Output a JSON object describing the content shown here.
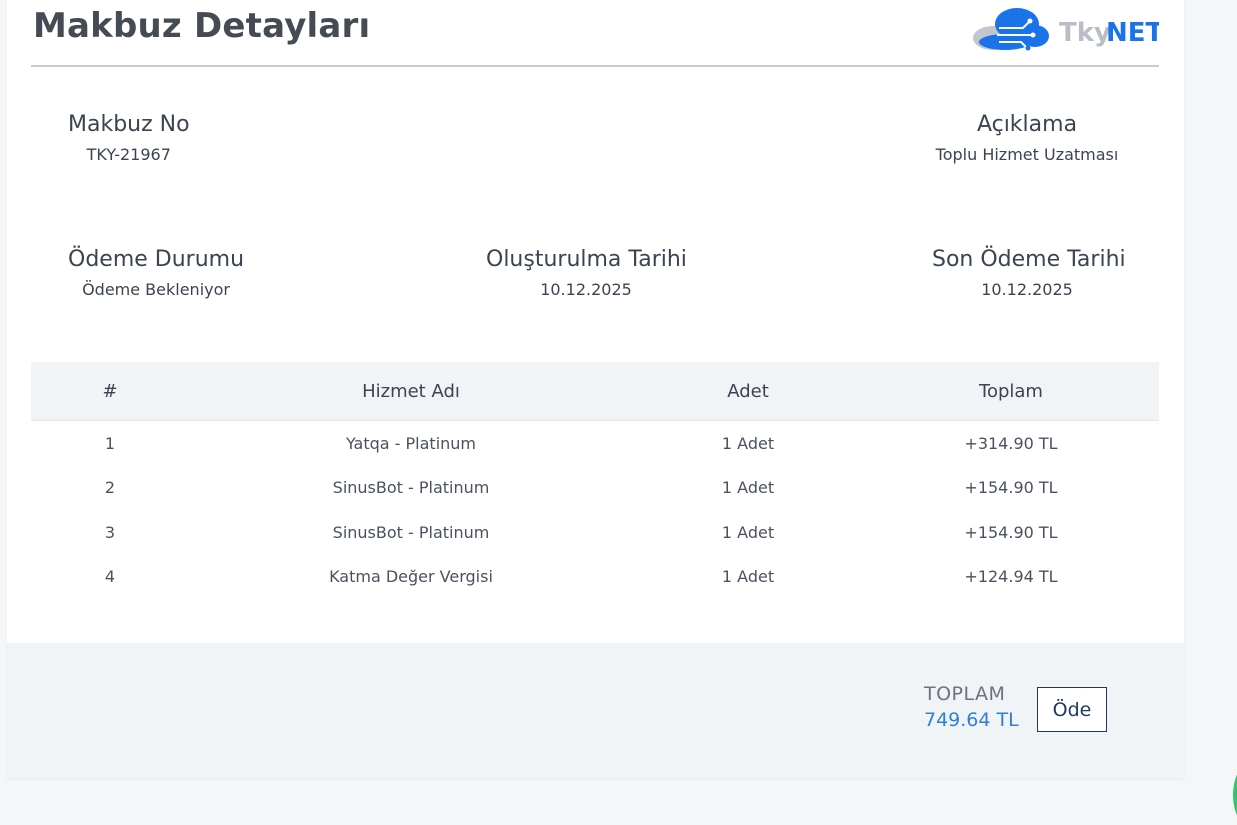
{
  "header": {
    "title": "Makbuz Detayları",
    "logo_text_1": "Tky",
    "logo_text_2": "NET"
  },
  "info": {
    "receipt_no": {
      "label": "Makbuz No",
      "value": "TKY-21967"
    },
    "description": {
      "label": "Açıklama",
      "value": "Toplu Hizmet Uzatması"
    },
    "payment_status": {
      "label": "Ödeme Durumu",
      "value": "Ödeme Bekleniyor"
    },
    "created_date": {
      "label": "Oluşturulma Tarihi",
      "value": "10.12.2025"
    },
    "due_date": {
      "label": "Son Ödeme Tarihi",
      "value": "10.12.2025"
    }
  },
  "table": {
    "headers": [
      "#",
      "Hizmet Adı",
      "Adet",
      "Toplam"
    ],
    "rows": [
      [
        "1",
        "Yatqa - Platinum",
        "1 Adet",
        "+314.90 TL"
      ],
      [
        "2",
        "SinusBot - Platinum",
        "1 Adet",
        "+154.90 TL"
      ],
      [
        "3",
        "SinusBot - Platinum",
        "1 Adet",
        "+154.90 TL"
      ],
      [
        "4",
        "Katma Değer Vergisi",
        "1 Adet",
        "+124.94 TL"
      ]
    ]
  },
  "footer": {
    "total_label": "TOPLAM",
    "total_value": "749.64 TL",
    "pay_label": "Öde"
  },
  "colors": {
    "accent": "#2f7fd6",
    "button_border": "#1e3a5f",
    "logo_blue": "#1a73e8",
    "logo_gray": "#b9bec6"
  },
  "icons": {
    "logo": "tkynet-cloud-logo"
  }
}
